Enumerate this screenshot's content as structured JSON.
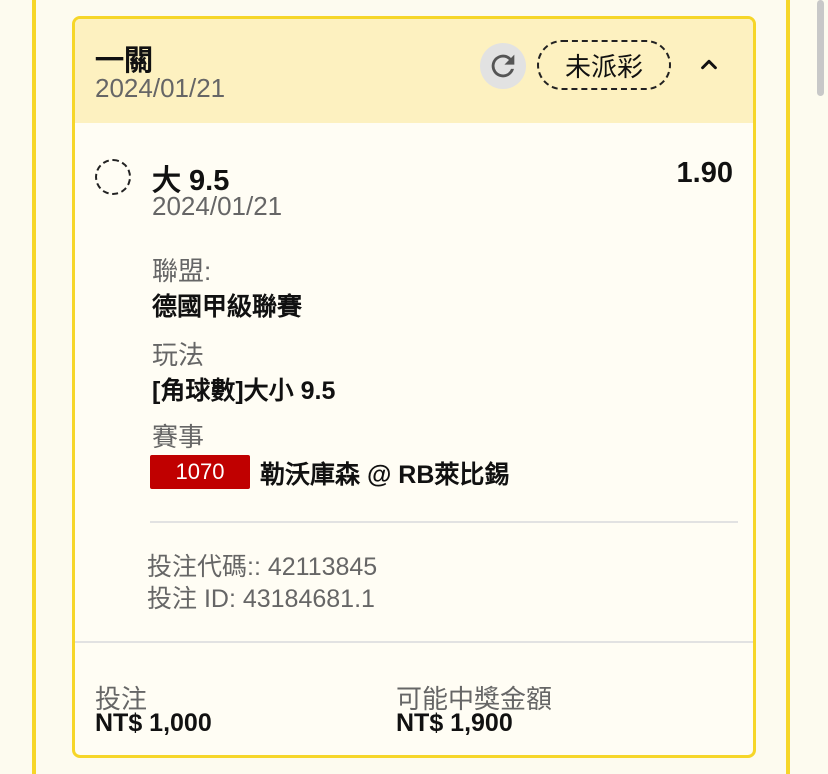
{
  "header": {
    "title": "一關",
    "date": "2024/01/21",
    "status": "未派彩",
    "refresh_icon": "refresh-icon",
    "collapse_icon": "chevron-up-icon"
  },
  "selection": {
    "name": "大 9.5",
    "date": "2024/01/21",
    "odds": "1.90"
  },
  "details": {
    "league_label": "聯盟:",
    "league_value": "德國甲級聯賽",
    "market_label": "玩法",
    "market_value": "[角球數]大小 9.5",
    "event_label": "賽事",
    "event_id": "1070",
    "event_name": "勒沃庫森 @ RB萊比錫"
  },
  "codes": {
    "bet_code": "投注代碼:: 42113845",
    "bet_id": "投注 ID: 43184681.1"
  },
  "footer": {
    "stake_label": "投注",
    "stake_value": "NT$ 1,000",
    "payout_label": "可能中獎金額",
    "payout_value": "NT$ 1,900"
  },
  "colors": {
    "accent": "#f6d629",
    "header_bg": "#fdf1c0",
    "badge_red": "#c00000"
  }
}
